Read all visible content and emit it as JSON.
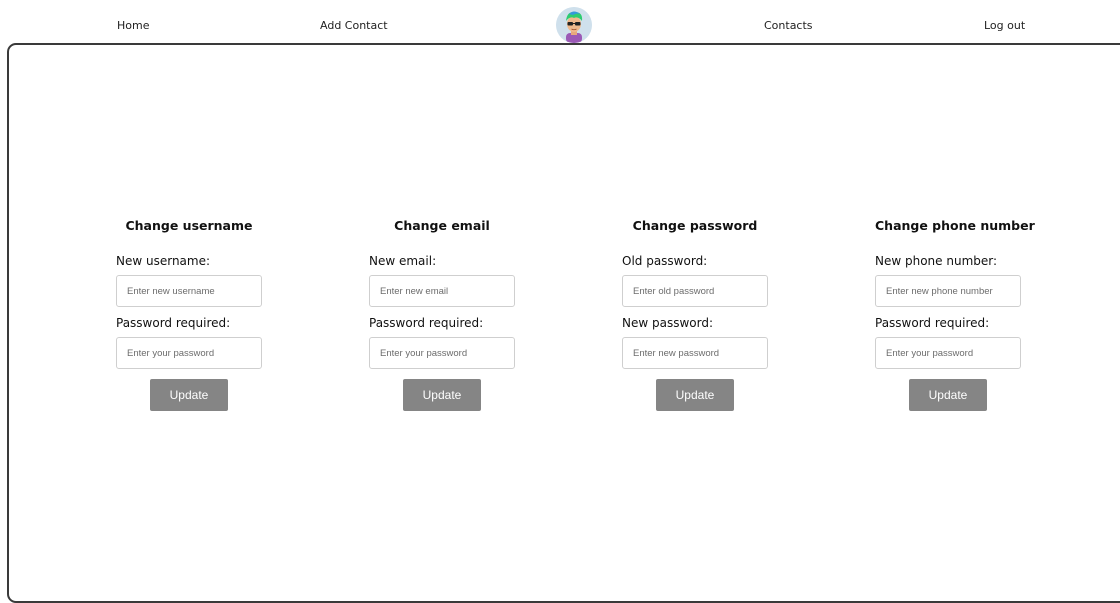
{
  "nav": {
    "home": "Home",
    "add_contact": "Add Contact",
    "contacts": "Contacts",
    "logout": "Log out"
  },
  "colors": {
    "button_bg": "#858585",
    "frame_border": "#3a3a3a",
    "input_border": "#cfcfcf"
  },
  "forms": {
    "username": {
      "title": "Change username",
      "label1": "New username:",
      "placeholder1": "Enter new username",
      "label2": "Password required:",
      "placeholder2": "Enter your password",
      "button": "Update"
    },
    "email": {
      "title": "Change email",
      "label1": "New email:",
      "placeholder1": "Enter new email",
      "label2": "Password required:",
      "placeholder2": "Enter your password",
      "button": "Update"
    },
    "password": {
      "title": "Change password",
      "label1": "Old password:",
      "placeholder1": "Enter old password",
      "label2": "New password:",
      "placeholder2": "Enter new password",
      "button": "Update"
    },
    "phone": {
      "title": "Change phone number",
      "label1": "New phone number:",
      "placeholder1": "Enter new phone number",
      "label2": "Password required:",
      "placeholder2": "Enter your password",
      "button": "Update"
    }
  }
}
